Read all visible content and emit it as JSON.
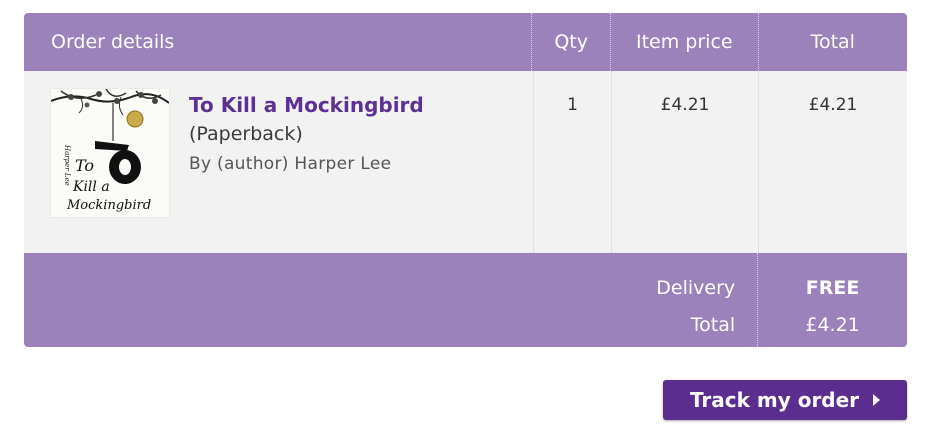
{
  "header": {
    "order_details": "Order details",
    "qty": "Qty",
    "item_price": "Item price",
    "total": "Total"
  },
  "item": {
    "title": "To Kill a Mockingbird",
    "format": "(Paperback)",
    "author": "By (author) Harper Lee",
    "qty": "1",
    "item_price": "£4.21",
    "total": "£4.21",
    "cover_text": {
      "author_script": "Harper Lee",
      "title_script_1": "To",
      "title_script_2": "Kill a",
      "title_script_3": "Mockingbird"
    }
  },
  "summary": {
    "delivery_label": "Delivery",
    "delivery_value": "FREE",
    "total_label": "Total",
    "total_value": "£4.21"
  },
  "actions": {
    "track_label": "Track my order"
  },
  "colors": {
    "header_bg": "#9b82bb",
    "row_bg": "#f2f2f2",
    "title_link": "#5d3194",
    "button_bg": "#5a2d8f"
  }
}
